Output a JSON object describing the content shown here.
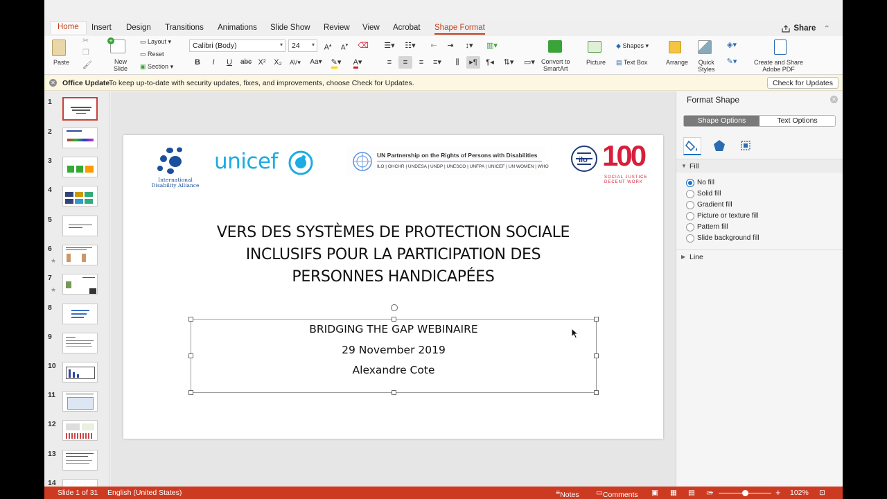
{
  "tabs": [
    "Home",
    "Insert",
    "Design",
    "Transitions",
    "Animations",
    "Slide Show",
    "Review",
    "View",
    "Acrobat",
    "Shape Format"
  ],
  "share_label": "Share",
  "ribbon": {
    "paste": "Paste",
    "new_slide_line1": "New",
    "new_slide_line2": "Slide",
    "layout": "Layout",
    "reset": "Reset",
    "section": "Section",
    "font_name": "Calibri (Body)",
    "font_size": "24",
    "bold": "B",
    "italic": "I",
    "underline": "U",
    "strike": "abc",
    "superscript": "X²",
    "subscript": "X₂",
    "convert_smartart_line1": "Convert to",
    "convert_smartart_line2": "SmartArt",
    "picture": "Picture",
    "shapes": "Shapes",
    "text_box": "Text Box",
    "arrange": "Arrange",
    "quick_styles_line1": "Quick",
    "quick_styles_line2": "Styles",
    "create_pdf_line1": "Create and Share",
    "create_pdf_line2": "Adobe PDF"
  },
  "update_bar": {
    "title": "Office Update",
    "message": "To keep up-to-date with security updates, fixes, and improvements, choose Check for Updates.",
    "button": "Check for Updates"
  },
  "thumbnails": [
    "1",
    "2",
    "3",
    "4",
    "5",
    "6",
    "7",
    "8",
    "9",
    "10",
    "11",
    "12",
    "13",
    "14"
  ],
  "slide": {
    "logos": {
      "ida_line1": "International",
      "ida_line2": "Disability Alliance",
      "unicef": "unicef",
      "un_partnership": "UN Partnership on the Rights of Persons with Disabilities",
      "un_agencies": "ILO | OHCHR | UNDESA | UNDP | UNESCO | UNFPA | UNICEF | UN WOMEN | WHO",
      "ilo_100": "100",
      "ilo_tagline_1": "SOCIAL JUSTICE",
      "ilo_tagline_2": "DECENT WORK"
    },
    "title_line1": "VERS DES SYSTÈMES DE PROTECTION SOCIALE",
    "title_line2": "INCLUSIFS POUR LA PARTICIPATION DES",
    "title_line3": "PERSONNES HANDICAPÉES",
    "subtitle_line1": "BRIDGING THE GAP WEBINAIRE",
    "subtitle_line2": "29 November 2019",
    "subtitle_line3": "Alexandre Cote"
  },
  "format_pane": {
    "title": "Format Shape",
    "shape_options": "Shape Options",
    "text_options": "Text Options",
    "fill_section": "Fill",
    "fill_options": [
      "No fill",
      "Solid fill",
      "Gradient fill",
      "Picture or texture fill",
      "Pattern fill",
      "Slide background fill"
    ],
    "line_section": "Line"
  },
  "status_bar": {
    "slide_counter": "Slide 1 of 31",
    "language": "English (United States)",
    "notes": "Notes",
    "comments": "Comments",
    "zoom": "102%"
  },
  "colors": {
    "accent": "#c43e1c",
    "status_bar": "#cc3b21",
    "unicef_blue": "#1cabe2",
    "ilo_red": "#d71f3c"
  }
}
